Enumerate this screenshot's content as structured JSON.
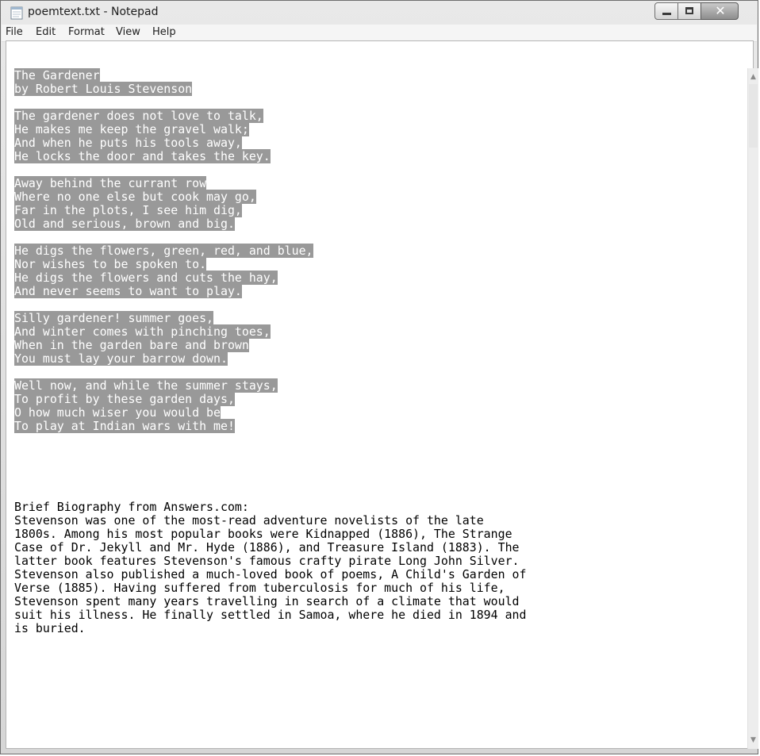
{
  "window": {
    "title": "poemtext.txt - Notepad",
    "close_glyph": "✕"
  },
  "menu": [
    "File",
    "Edit",
    "Format",
    "View",
    "Help"
  ],
  "document": {
    "selected_lines": [
      "The Gardener",
      "by Robert Louis Stevenson",
      "",
      "The gardener does not love to talk,",
      "He makes me keep the gravel walk;",
      "And when he puts his tools away,",
      "He locks the door and takes the key.",
      "",
      "Away behind the currant row",
      "Where no one else but cook may go,",
      "Far in the plots, I see him dig,",
      "Old and serious, brown and big.",
      "",
      "He digs the flowers, green, red, and blue,",
      "Nor wishes to be spoken to.",
      "He digs the flowers and cuts the hay,",
      "And never seems to want to play.",
      "",
      "Silly gardener! summer goes,",
      "And winter comes with pinching toes,",
      "When in the garden bare and brown",
      "You must lay your barrow down.",
      "",
      "Well now, and while the summer stays,",
      "To profit by these garden days,",
      "O how much wiser you would be",
      "To play at Indian wars with me!"
    ],
    "plain_lines": [
      "",
      "",
      "",
      "",
      "",
      "Brief Biography from Answers.com:",
      "Stevenson was one of the most-read adventure novelists of the late",
      "1800s. Among his most popular books were Kidnapped (1886), The Strange",
      "Case of Dr. Jekyll and Mr. Hyde (1886), and Treasure Island (1883). The",
      "latter book features Stevenson's famous crafty pirate Long John Silver.",
      "Stevenson also published a much-loved book of poems, A Child's Garden of",
      "Verse (1885). Having suffered from tuberculosis for much of his life,",
      "Stevenson spent many years travelling in search of a climate that would",
      "suit his illness. He finally settled in Samoa, where he died in 1894 and",
      "is buried."
    ]
  },
  "scrollbar": {
    "up_glyph": "▲",
    "down_glyph": "▼"
  }
}
